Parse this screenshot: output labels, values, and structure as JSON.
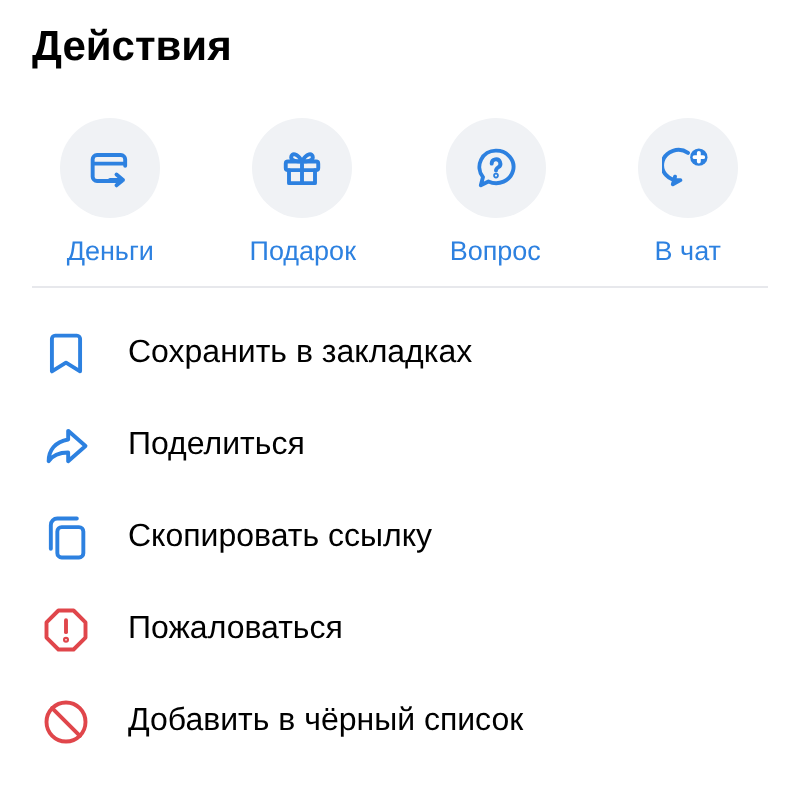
{
  "title": "Действия",
  "quick_actions": [
    {
      "label": "Деньги"
    },
    {
      "label": "Подарок"
    },
    {
      "label": "Вопрос"
    },
    {
      "label": "В чат"
    }
  ],
  "menu": [
    {
      "label": "Сохранить в закладках",
      "kind": "normal"
    },
    {
      "label": "Поделиться",
      "kind": "normal"
    },
    {
      "label": "Скопировать ссылку",
      "kind": "normal"
    },
    {
      "label": "Пожаловаться",
      "kind": "danger"
    },
    {
      "label": "Добавить в чёрный список",
      "kind": "danger"
    }
  ]
}
